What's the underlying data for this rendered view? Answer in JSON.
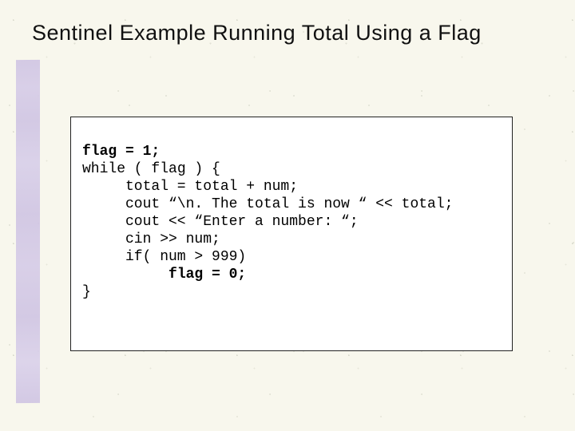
{
  "title": "Sentinel Example Running Total Using a Flag",
  "code": {
    "l1a": "flag = 1;",
    "l2": "while ( flag ) {",
    "l3": "total = total + num;",
    "l4": "cout “\\n. The total is now “ << total;",
    "l5": "cout << “Enter a number: “;",
    "l6": "cin >> num;",
    "l7": "if( num > 999)",
    "l8": "flag = 0;",
    "l9": "}"
  }
}
